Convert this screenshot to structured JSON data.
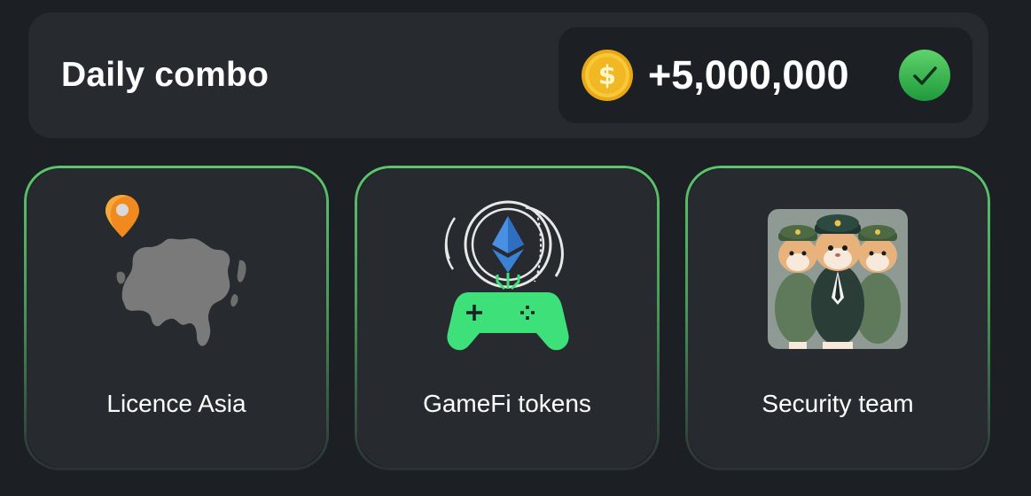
{
  "header": {
    "title": "Daily combo",
    "reward_amount": "+5,000,000",
    "coin_icon": "coin-dollar-icon",
    "status_icon": "check-circle-icon"
  },
  "cards": [
    {
      "label": "Licence Asia",
      "icon": "asia-map-pin-icon"
    },
    {
      "label": "GameFi tokens",
      "icon": "ethereum-gamepad-icon"
    },
    {
      "label": "Security team",
      "icon": "hamster-guards-image"
    }
  ],
  "colors": {
    "background": "#1c1f24",
    "panel": "#272a2f",
    "accent_green": "#5cc66c",
    "coin_gold": "#f5c332",
    "gamepad_green": "#3ee07a",
    "eth_blue": "#4a90e2"
  }
}
